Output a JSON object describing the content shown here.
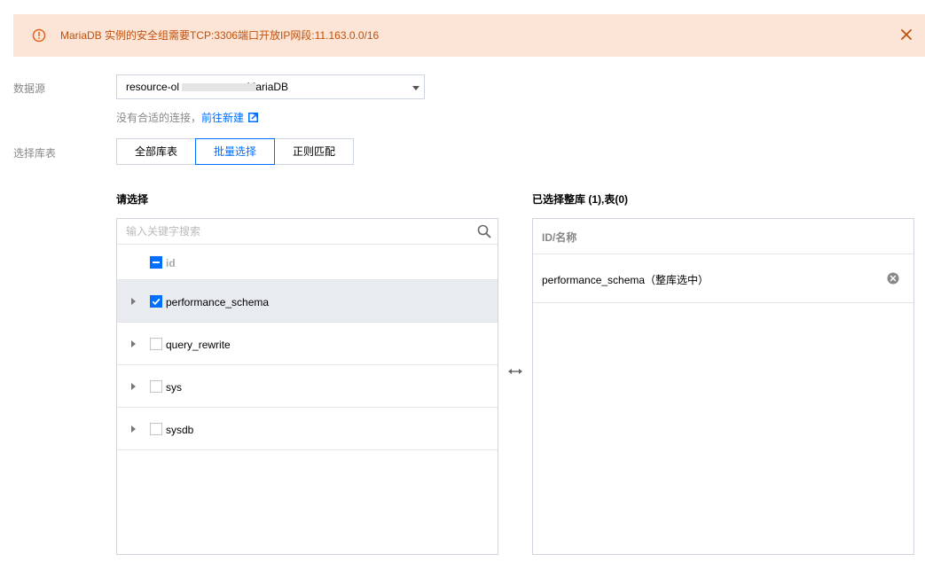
{
  "alert": {
    "message": "MariaDB 实例的安全组需要TCP:3306端口开放IP网段:11.163.0.0/16",
    "icon": "warning-circle-icon",
    "close_icon": "close-icon",
    "color": "#c0510c",
    "background": "#fce4d6"
  },
  "datasource": {
    "label": "数据源",
    "select_value_prefix": "resource-ol",
    "select_value_suffix": "tMariaDB",
    "hint_text": "没有合适的连接，",
    "hint_link": "前往新建"
  },
  "table_select": {
    "label": "选择库表",
    "modes": [
      "全部库表",
      "批量选择",
      "正则匹配"
    ],
    "active_mode": "批量选择"
  },
  "left_panel": {
    "title": "请选择",
    "search_placeholder": "输入关键字搜索",
    "header_label": "id",
    "items": [
      {
        "label": "performance_schema",
        "checked": true
      },
      {
        "label": "query_rewrite",
        "checked": false
      },
      {
        "label": "sys",
        "checked": false
      },
      {
        "label": "sysdb",
        "checked": false
      }
    ]
  },
  "right_panel": {
    "title": "已选择整库 (1),表(0)",
    "header_label": "ID/名称",
    "items": [
      {
        "label": "performance_schema（整库选中）"
      }
    ]
  },
  "colors": {
    "accent": "#006eff",
    "border": "#cfd5de",
    "selected_row": "#e8ecf1"
  }
}
